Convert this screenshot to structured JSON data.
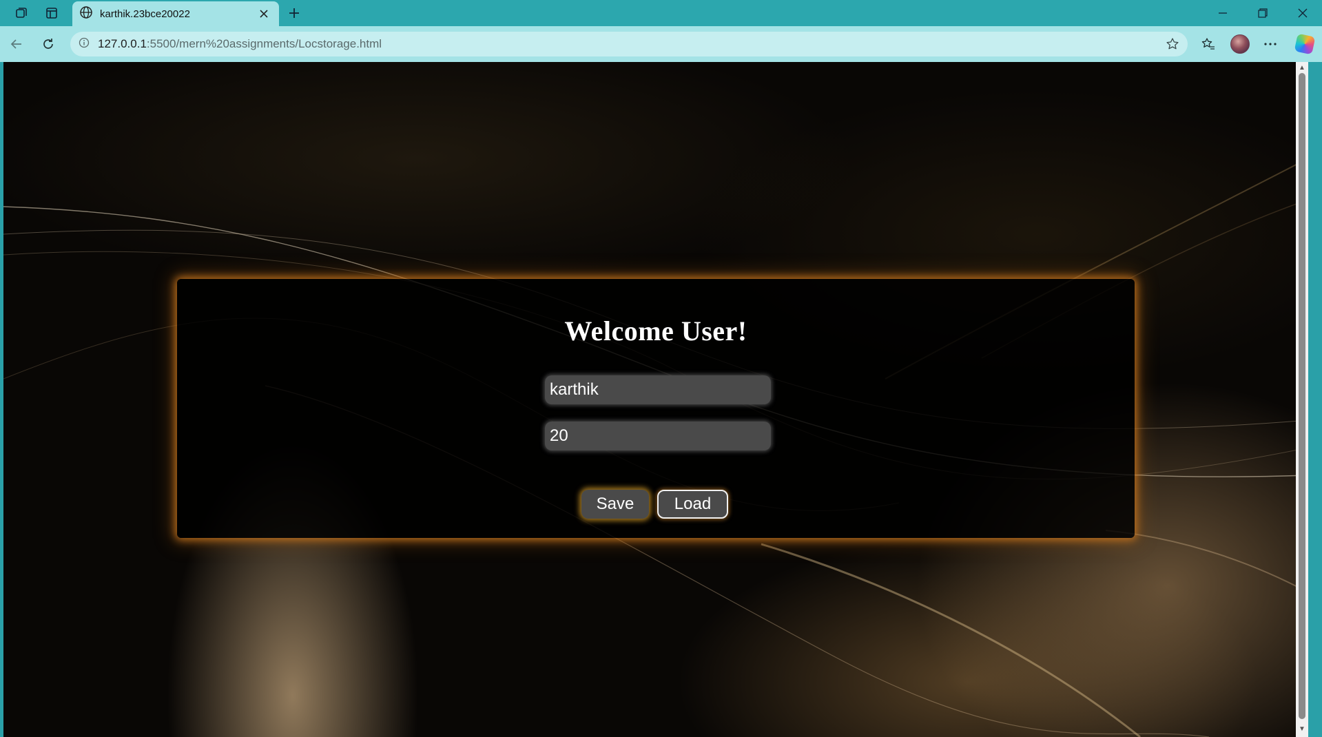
{
  "tab": {
    "title": "karthik.23bce20022"
  },
  "address_bar": {
    "url_host": "127.0.0.1",
    "url_rest": ":5500/mern%20assignments/Locstorage.html"
  },
  "page": {
    "heading": "Welcome User!",
    "name_field": {
      "value": "karthik"
    },
    "age_field": {
      "value": "20"
    },
    "save_label": "Save",
    "load_label": "Load"
  },
  "colors": {
    "chrome_teal": "#2ca7ae",
    "toolbar_teal": "#a4e3e6",
    "card_glow": "#cd781e",
    "input_gray": "#4a4a4a"
  }
}
